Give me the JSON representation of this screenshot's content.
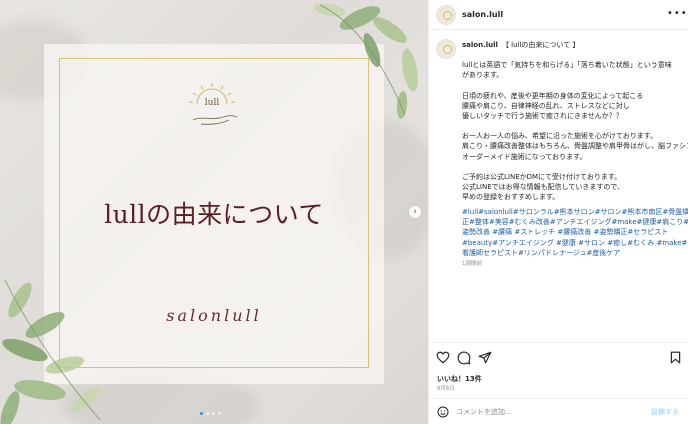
{
  "media": {
    "logo_text": "lull",
    "headline": "lullの由来について",
    "script_text": "salonlull"
  },
  "post": {
    "username": "salon.lull",
    "more_icon": "more-horizontal-icon",
    "caption_title": "【 lullの由来について 】",
    "caption_lines_1": [
      "lullとは英語で「気持ちを和らげる」「落ち着いた状態」という意味",
      "があります。"
    ],
    "caption_lines_2": [
      "日頃の疲れや、産後や更年期の身体の変化によって起こる",
      "腰痛や肩こり、自律神経の乱れ、ストレスなどに対し",
      "優しいタッチで行う施術で癒されにきませんか？？"
    ],
    "caption_lines_3": [
      "お一人お一人の悩み、希望に沿った施術を心がけております。",
      "肩こり・腰痛改善整体はもちろん、骨盤調整や肩甲骨はがし、脳ファシアなど",
      "オーダーメイド施術になっております。"
    ],
    "caption_lines_4": [
      "ご予約は公式LINEかDMにて受け付けております。",
      "公式LINEではお得な情報も配信していきますので、",
      "早めの登録をおすすめします。"
    ],
    "hashtag_lines": [
      "#lull#salonlull#サロンラル#熊本サロン#サロン#熊本市南区#骨盤矯",
      "正#整体#美容#むくみ改善#アンチエイジング#make#健康#肩こり#",
      "姿勢改善 #腰痛 #ストレッチ #腰痛改善 #姿勢矯正#セラピスト",
      "#beauty#アンチエイジング #健康 #サロン #癒し#むくみ #make#",
      "看護師セラピスト#リンパドレナージュ#産後ケア"
    ],
    "time_ago": "1週間前",
    "likes": "いいね！13件",
    "date": "8月6日",
    "comment_placeholder": "コメントを追加...",
    "post_button": "投稿する"
  },
  "colors": {
    "headline": "#5c1e24",
    "frame": "#d8c27a",
    "hashtag": "#1e5fa8",
    "post_button_disabled": "#b2dffc"
  }
}
